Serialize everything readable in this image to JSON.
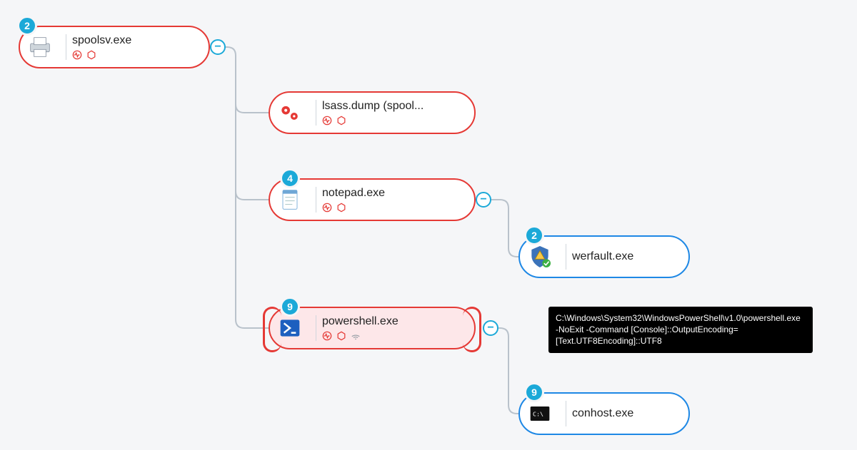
{
  "nodes": {
    "spoolsv": {
      "label": "spoolsv.exe",
      "badge": "2",
      "toggle": "−",
      "color": "red",
      "icon": "printer"
    },
    "lsass": {
      "label": "lsass.dump (spool...",
      "color": "red",
      "icon": "gears"
    },
    "notepad": {
      "label": "notepad.exe",
      "badge": "4",
      "toggle": "−",
      "color": "red",
      "icon": "notepad"
    },
    "werfault": {
      "label": "werfault.exe",
      "badge": "2",
      "color": "blue",
      "icon": "shield-warn"
    },
    "powershell": {
      "label": "powershell.exe",
      "badge": "9",
      "toggle": "−",
      "color": "red-fill",
      "icon": "powershell"
    },
    "conhost": {
      "label": "conhost.exe",
      "badge": "9",
      "color": "blue",
      "icon": "terminal"
    }
  },
  "tooltip": {
    "text": "C:\\Windows\\System32\\WindowsPowerShell\\v1.0\\powershell.exe -NoExit -Command [Console]::OutputEncoding=[Text.UTF8Encoding]::UTF8"
  }
}
